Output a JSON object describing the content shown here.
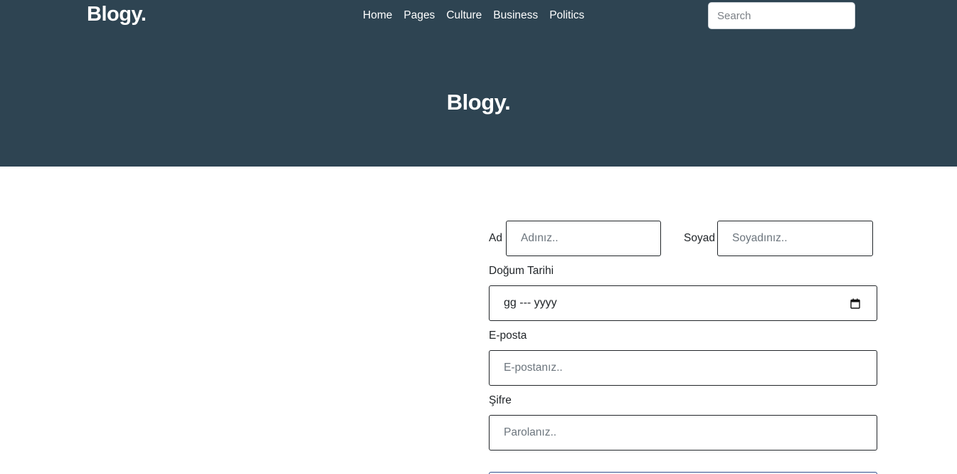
{
  "header": {
    "brand": "Blogy.",
    "nav": [
      {
        "label": "Home"
      },
      {
        "label": "Pages"
      },
      {
        "label": "Culture"
      },
      {
        "label": "Business"
      },
      {
        "label": "Politics"
      }
    ],
    "search_placeholder": "Search",
    "background_color": "#2e4452"
  },
  "hero": {
    "title": "Blogy."
  },
  "form": {
    "first_name_label": "Ad",
    "first_name_placeholder": "Adınız..",
    "last_name_label": "Soyad",
    "last_name_placeholder": "Soyadınız..",
    "birthdate_label": "Doğum Tarihi",
    "birthdate_value": "gg --- yyyy",
    "birthdate_icon": "calendar-icon",
    "email_label": "E-posta",
    "email_placeholder": "E-postanız..",
    "password_label": "Şifre",
    "password_placeholder": "Parolanız.."
  }
}
